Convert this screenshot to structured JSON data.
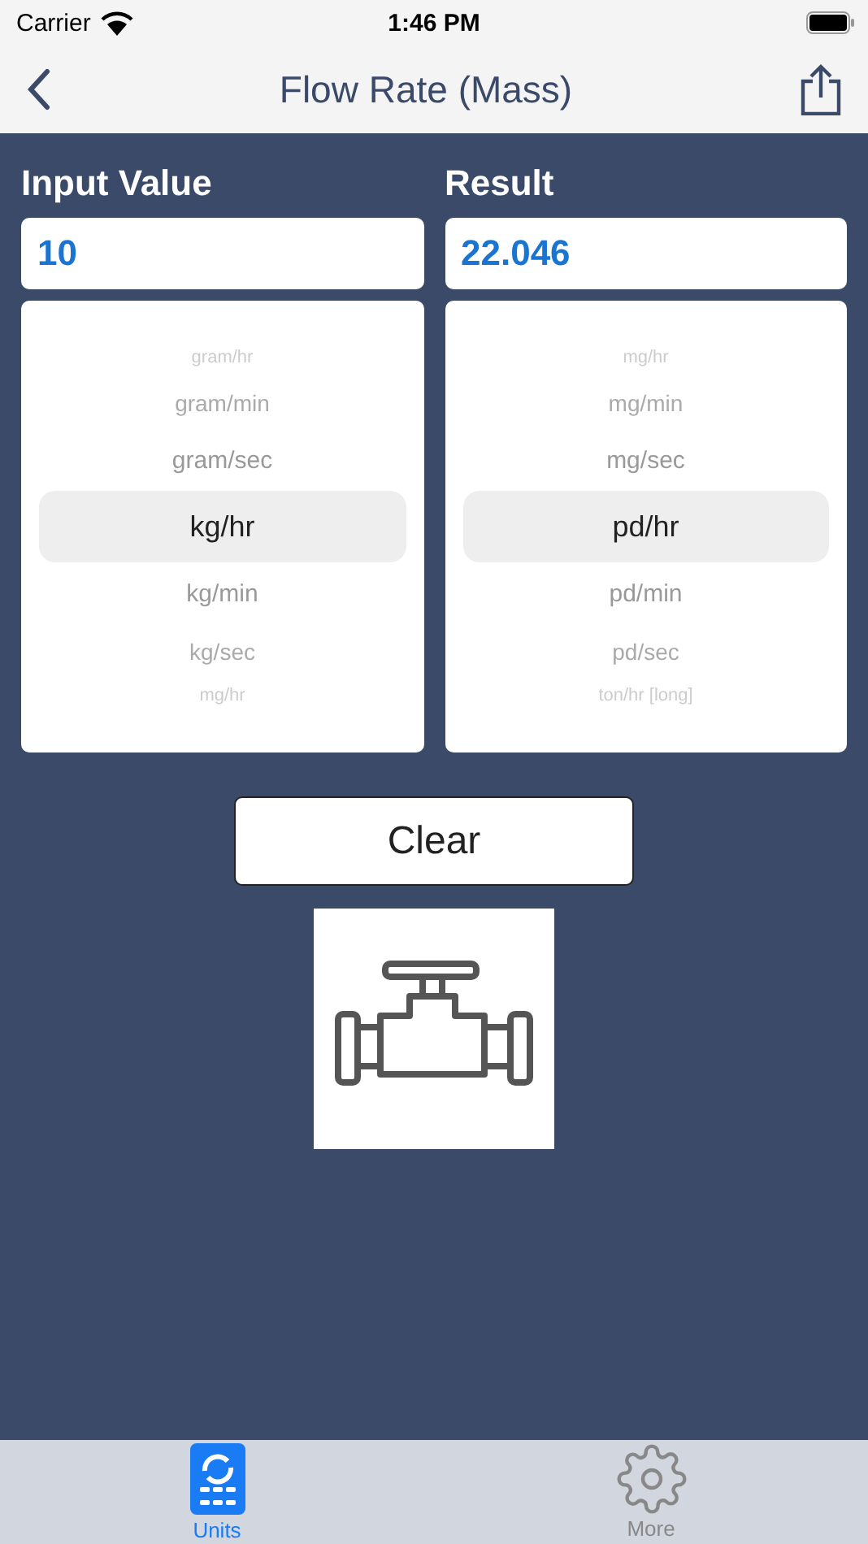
{
  "status_bar": {
    "carrier": "Carrier",
    "time": "1:46 PM"
  },
  "nav": {
    "title": "Flow Rate (Mass)"
  },
  "input": {
    "label": "Input Value",
    "value": "10",
    "units": [
      {
        "label": "gram/hr",
        "selected": false
      },
      {
        "label": "gram/min",
        "selected": false
      },
      {
        "label": "gram/sec",
        "selected": false
      },
      {
        "label": "kg/hr",
        "selected": true
      },
      {
        "label": "kg/min",
        "selected": false
      },
      {
        "label": "kg/sec",
        "selected": false
      },
      {
        "label": "mg/hr",
        "selected": false
      }
    ]
  },
  "result": {
    "label": "Result",
    "value": "22.046",
    "units": [
      {
        "label": "mg/hr",
        "selected": false
      },
      {
        "label": "mg/min",
        "selected": false
      },
      {
        "label": "mg/sec",
        "selected": false
      },
      {
        "label": "pd/hr",
        "selected": true
      },
      {
        "label": "pd/min",
        "selected": false
      },
      {
        "label": "pd/sec",
        "selected": false
      },
      {
        "label": "ton/hr [long]",
        "selected": false
      }
    ]
  },
  "clear_button": "Clear",
  "tabs": [
    {
      "label": "Units",
      "kind": "units",
      "selected": true
    },
    {
      "label": "More",
      "kind": "more",
      "selected": false
    }
  ]
}
